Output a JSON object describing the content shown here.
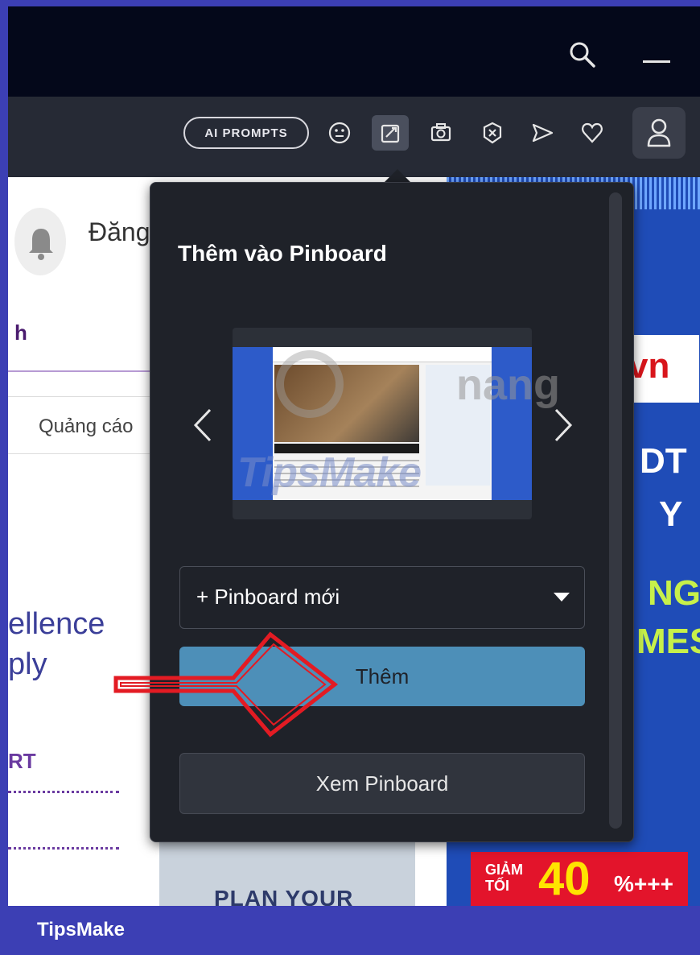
{
  "titlebar": {
    "search_icon": "search-icon",
    "minimize_icon": "minimize-icon"
  },
  "toolbar": {
    "ai_prompts_label": "AI PROMPTS",
    "icons": [
      "smile-icon",
      "pin-icon",
      "camera-icon",
      "close-shield-icon",
      "send-icon",
      "heart-icon",
      "profile-icon"
    ]
  },
  "page": {
    "dang": "Đăng",
    "heading_fragment": "h",
    "ads_label": "Quảng cáo",
    "headline": [
      "ellence",
      "ply"
    ],
    "section_fragment": "RT",
    "plan_text": "PLAN YOUR"
  },
  "ad": {
    "logo_text": "vn",
    "lines": [
      "DT",
      "Y"
    ],
    "green_lines": [
      "NG",
      "MES"
    ],
    "sale_label": "GIẢM TỐI",
    "sale_value": "40",
    "sale_suffix": "%+++"
  },
  "popup": {
    "title": "Thêm vào Pinboard",
    "preview_watermark": "TipsMake",
    "overlay_watermark": "nang",
    "select_label": "+ Pinboard mới",
    "add_button": "Thêm",
    "view_button": "Xem Pinboard"
  },
  "footer": {
    "brand": "TipsMake"
  },
  "colors": {
    "accent_blue": "#4d8fb8",
    "frame_blue": "#3c3fb4",
    "popup_bg": "#1f2229",
    "arrow_red": "#e31b23"
  }
}
